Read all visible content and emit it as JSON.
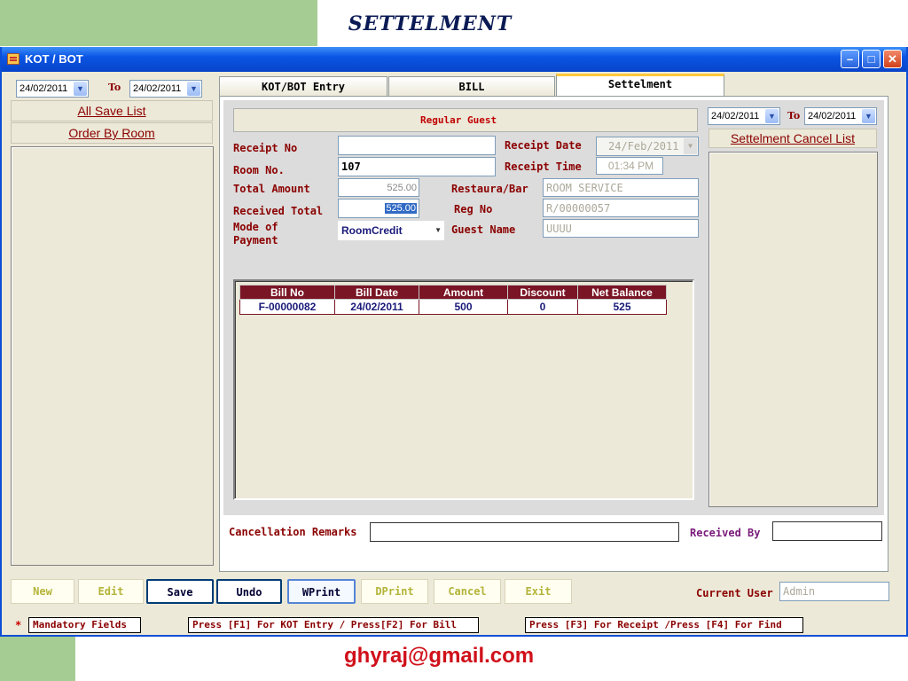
{
  "slide": {
    "title": "SETTELMENT",
    "footer": "ghyraj@gmail.com"
  },
  "window": {
    "title": "KOT / BOT",
    "controls": {
      "minimize": "–",
      "maximize": "□",
      "close": "✕"
    }
  },
  "left_panel": {
    "from_date": "24/02/2011",
    "to_label": "To",
    "to_date": "24/02/2011",
    "all_save_list": "All Save List",
    "order_by_room": "Order By Room"
  },
  "tabs": [
    {
      "label": "KOT/BOT Entry",
      "active": false
    },
    {
      "label": "BILL",
      "active": false
    },
    {
      "label": "Settelment",
      "active": true
    }
  ],
  "form": {
    "guest_type": "Regular Guest",
    "receipt_no_label": "Receipt No",
    "receipt_no": "",
    "room_no_label": "Room No.",
    "room_no": "107",
    "total_amount_label": "Total Amount",
    "total_amount": "525.00",
    "received_total_label": "Received Total",
    "received_total": "525.00",
    "mode_of_payment_label": "Mode of\nPayment",
    "mode_of_payment": "RoomCredit",
    "receipt_date_label": "Receipt Date",
    "receipt_date": "24/Feb/2011",
    "receipt_time_label": "Receipt Time",
    "receipt_time": "01:34 PM",
    "restaura_bar_label": "Restaura/Bar",
    "restaura_bar": "ROOM SERVICE",
    "reg_no_label": "Reg No",
    "reg_no": "R/00000057",
    "guest_name_label": "Guest Name",
    "guest_name": "UUUU"
  },
  "bill_table": {
    "headers": [
      "Bill No",
      "Bill Date",
      "Amount",
      "Discount",
      "Net Balance"
    ],
    "rows": [
      [
        "F-00000082",
        "24/02/2011",
        "500",
        "0",
        "525"
      ]
    ]
  },
  "right_panel": {
    "from_date": "24/02/2011",
    "to_label": "To",
    "to_date": "24/02/2011",
    "cancel_list": "Settelment Cancel List"
  },
  "remarks": {
    "cancellation_label": "Cancellation Remarks",
    "cancellation_value": "",
    "received_by_label": "Received By",
    "received_by_value": ""
  },
  "buttons": {
    "new": "New",
    "edit": "Edit",
    "save": "Save",
    "undo": "Undo",
    "wprint": "WPrint",
    "dprint": "DPrint",
    "cancel": "Cancel",
    "exit": "Exit"
  },
  "current_user": {
    "label": "Current User",
    "value": "Admin"
  },
  "status_bar": {
    "asterisk": "*",
    "mandatory": "Mandatory Fields",
    "hint1": "Press [F1] For KOT Entry / Press[F2] For Bill",
    "hint2": "Press [F3] For Receipt /Press [F4] For Find"
  },
  "colors": {
    "title_blue": "#0a55e4",
    "label_maroon": "#8b0000",
    "grid_header": "#7a1525",
    "slide_green": "#a5cd93",
    "footer_red": "#d0101a"
  }
}
